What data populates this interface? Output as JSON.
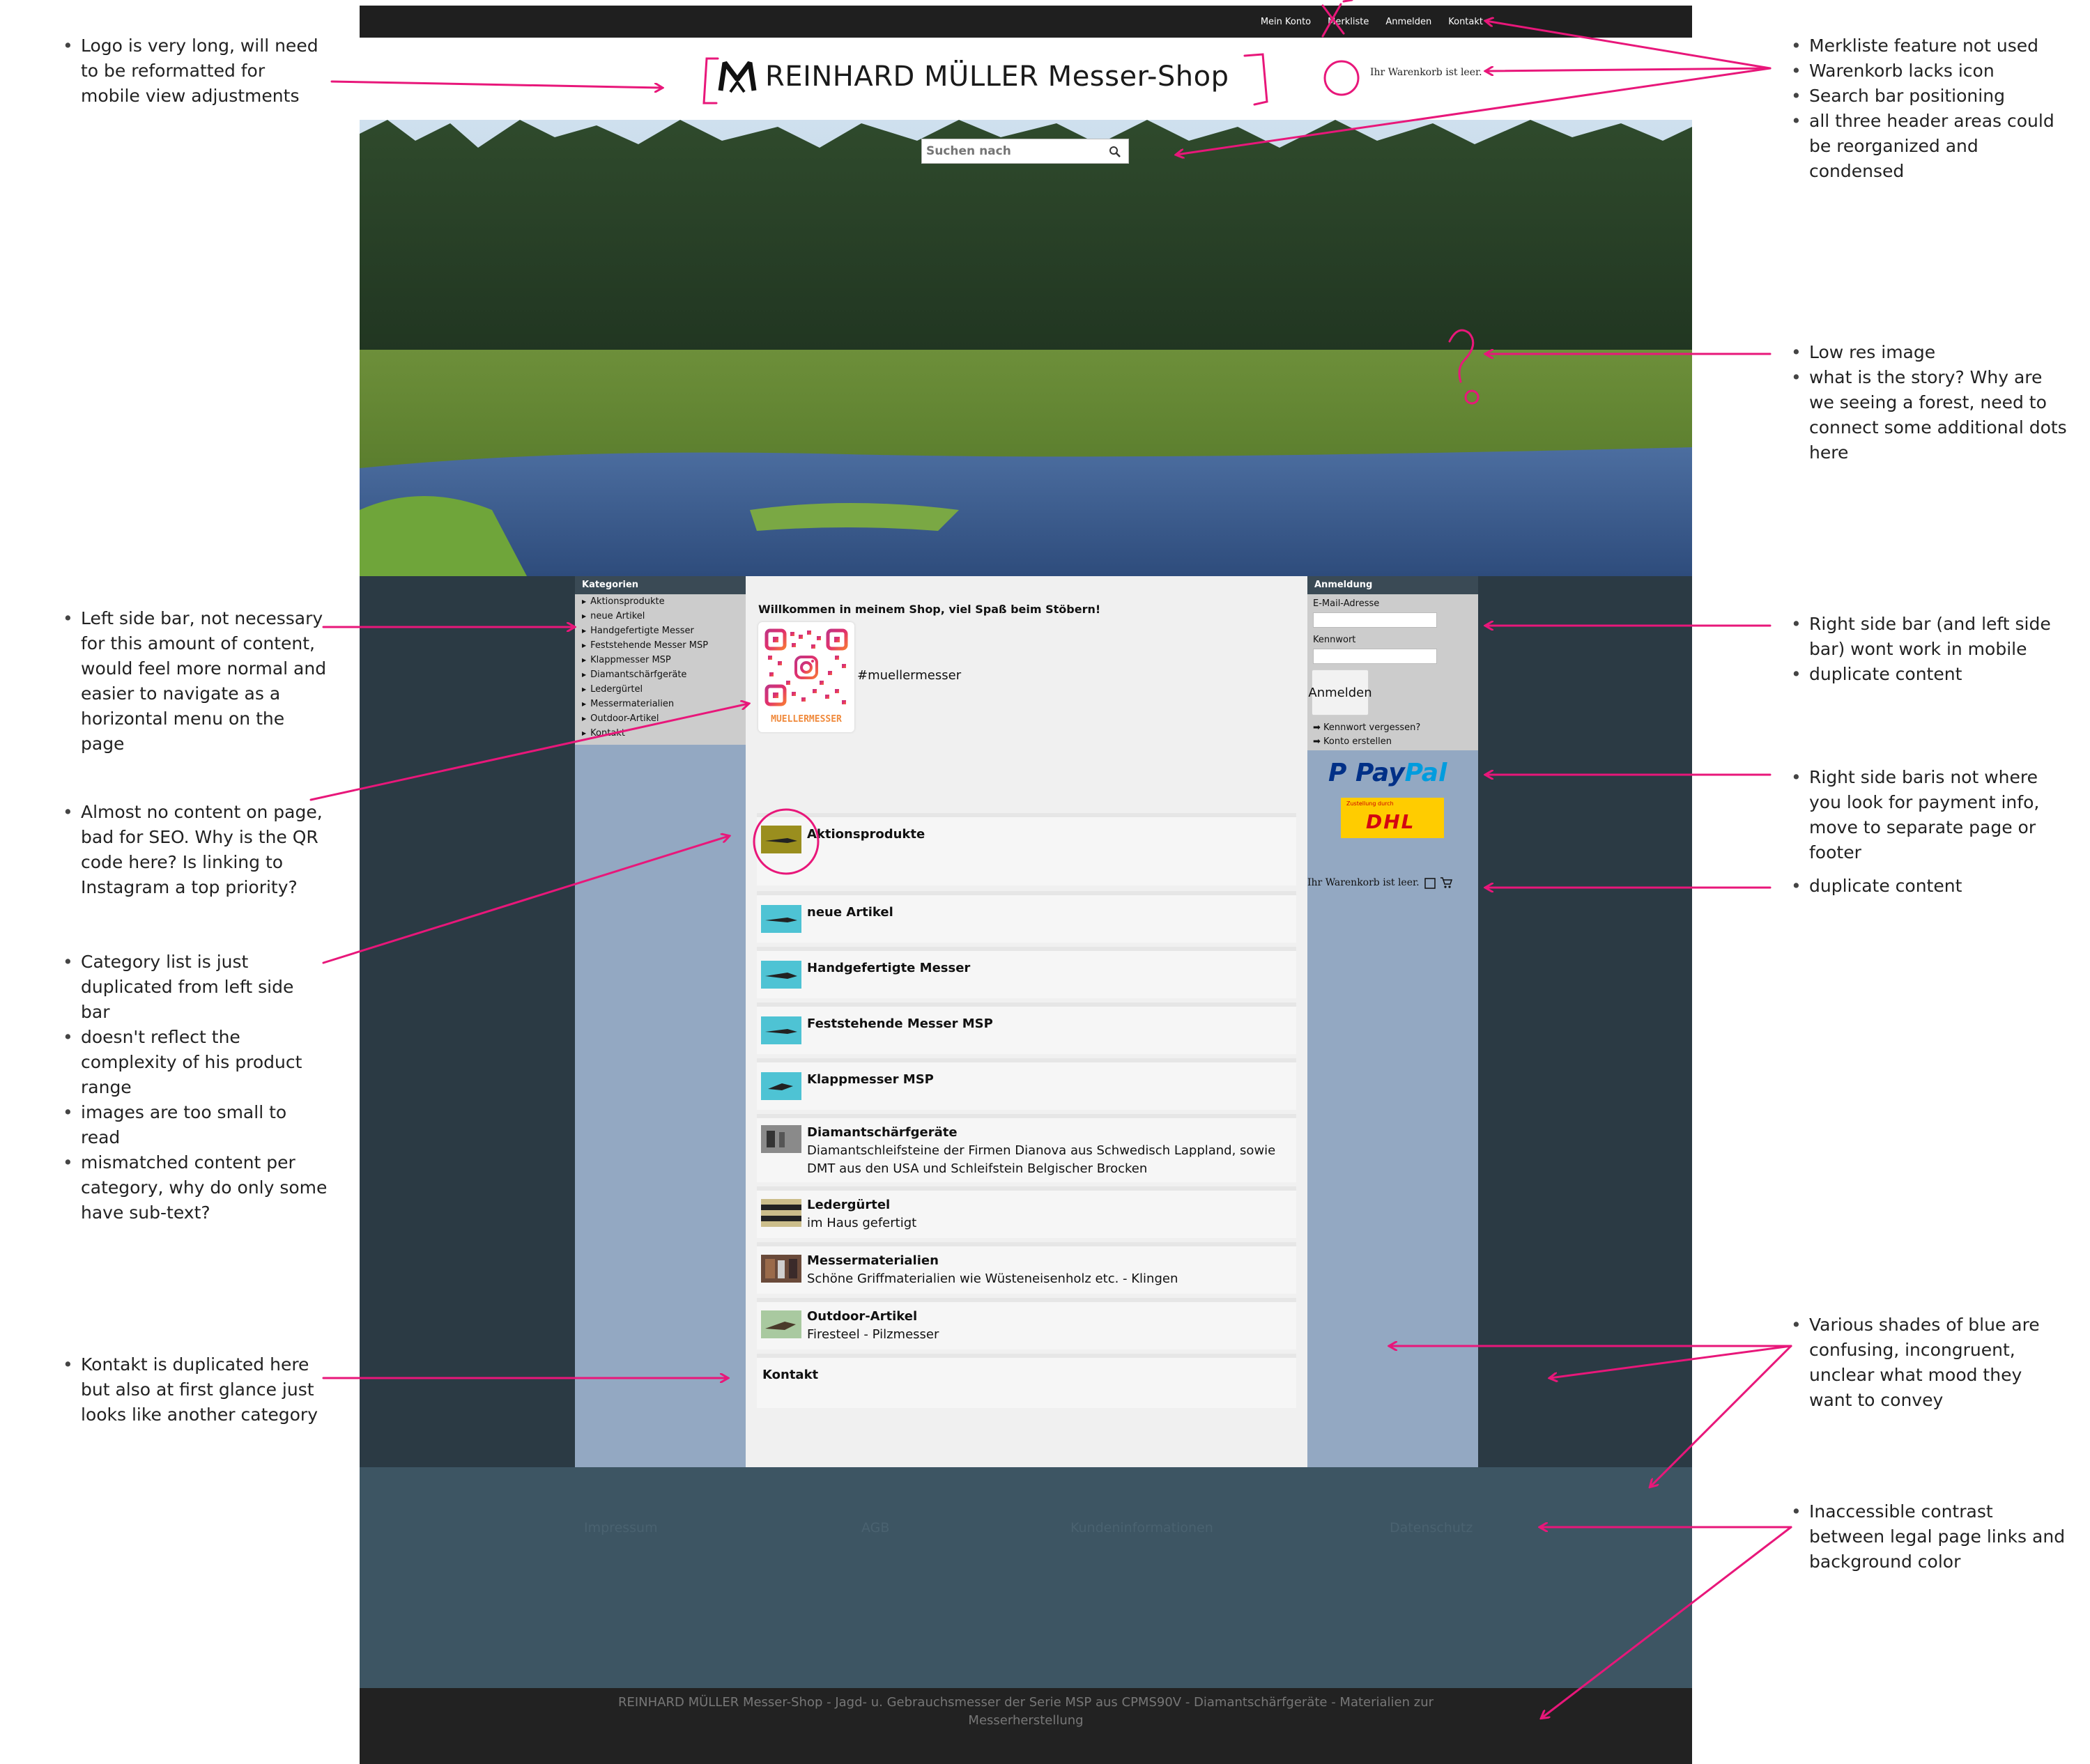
{
  "annotations_left": [
    {
      "id": "logo",
      "items": [
        "Logo is very long, will need to be reformatted for mobile view adjustments"
      ]
    },
    {
      "id": "sidebar",
      "items": [
        "Left side bar, not necessary for this amount of content, would feel more normal and easier to navigate as a horizontal menu on the page"
      ]
    },
    {
      "id": "seo",
      "items": [
        "Almost no content on page, bad for SEO. Why is the QR code here? Is linking to Instagram a top priority?"
      ]
    },
    {
      "id": "catlist",
      "items": [
        "Category list is just duplicated from left side bar",
        "doesn't reflect the complexity of his product range",
        "images are too small to read",
        "mismatched content per category, why do only some have sub-text?"
      ]
    },
    {
      "id": "kontakt",
      "items": [
        "Kontakt is duplicated here but also at first glance just looks like another category"
      ]
    }
  ],
  "annotations_right": [
    {
      "id": "header",
      "items": [
        "Merkliste feature not used",
        "Warenkorb lacks icon",
        "Search bar positioning",
        "all three header areas could be reorganized and condensed"
      ]
    },
    {
      "id": "image",
      "items": [
        "Low res image",
        "what is the story? Why are we seeing a forest, need to connect some additional dots here"
      ]
    },
    {
      "id": "rightbar",
      "items": [
        "Right side bar (and left side bar) wont work in mobile",
        "duplicate content"
      ]
    },
    {
      "id": "payment",
      "items": [
        "Right side baris not where you look for payment info, move to separate page or footer"
      ]
    },
    {
      "id": "dup",
      "items": [
        "duplicate content"
      ]
    },
    {
      "id": "blue",
      "items": [
        "Various shades of blue are confusing, incongruent, unclear what mood they want to convey"
      ]
    },
    {
      "id": "contrast",
      "items": [
        "Inaccessible contrast between legal page links and background color"
      ]
    }
  ],
  "topnav": [
    "Mein Konto",
    "Merkliste",
    "Anmelden",
    "Kontakt"
  ],
  "logo_text": "REINHARD MÜLLER Messer-Shop",
  "cart_top": "Ihr Warenkorb ist leer.",
  "search_placeholder": "Suchen nach",
  "sidebar": {
    "title": "Kategorien",
    "items": [
      "Aktionsprodukte",
      "neue Artikel",
      "Handgefertigte Messer",
      "Feststehende Messer MSP",
      "Klappmesser MSP",
      "Diamantschärfgeräte",
      "Ledergürtel",
      "Messermaterialien",
      "Outdoor-Artikel",
      "Kontakt"
    ]
  },
  "main": {
    "welcome": "Willkommen in meinem Shop, viel Spaß beim Stöbern!",
    "qr_caption": "MUELLERMESSER",
    "hashtag": "#muellermesser",
    "categories": [
      {
        "name": "Aktionsprodukte",
        "desc": ""
      },
      {
        "name": "neue Artikel",
        "desc": ""
      },
      {
        "name": "Handgefertigte Messer",
        "desc": ""
      },
      {
        "name": "Feststehende Messer MSP",
        "desc": ""
      },
      {
        "name": "Klappmesser MSP",
        "desc": ""
      },
      {
        "name": "Diamantschärfgeräte",
        "desc": "Diamantschleifsteine der Firmen Dianova aus Schwedisch Lappland, sowie DMT aus den USA und Schleifstein Belgischer Brocken"
      },
      {
        "name": "Ledergürtel",
        "desc": "im Haus gefertigt"
      },
      {
        "name": "Messermaterialien",
        "desc": "Schöne Griffmaterialien wie Wüsteneisenholz etc. - Klingen"
      },
      {
        "name": "Outdoor-Artikel",
        "desc": "Firesteel - Pilzmesser"
      },
      {
        "name": "Kontakt",
        "desc": ""
      }
    ]
  },
  "login": {
    "title": "Anmeldung",
    "email_label": "E-Mail-Adresse",
    "password_label": "Kennwort",
    "button": "Anmelden",
    "forgot": "➡ Kennwort vergessen?",
    "create": "➡ Konto erstellen"
  },
  "paypal": {
    "pay": "Pay",
    "pal": "Pal"
  },
  "dhl": {
    "small": "Zustellung durch",
    "big": "DHL"
  },
  "cart_right": "Ihr Warenkorb ist leer.",
  "footer_links": [
    "Impressum",
    "AGB",
    "Kundeninformationen",
    "Datenschutz"
  ],
  "copyright": "REINHARD MÜLLER Messer-Shop - Jagd- u. Gebrauchsmesser der Serie MSP aus CPMS90V - Diamantschärfgeräte - Materialien zur Messerherstellung",
  "colors": {
    "accent": "#e8177a",
    "topbar": "#1f1f1f",
    "content": "#2b3a44",
    "sidebar": "#93a8c2",
    "footer": "#3d5563"
  }
}
